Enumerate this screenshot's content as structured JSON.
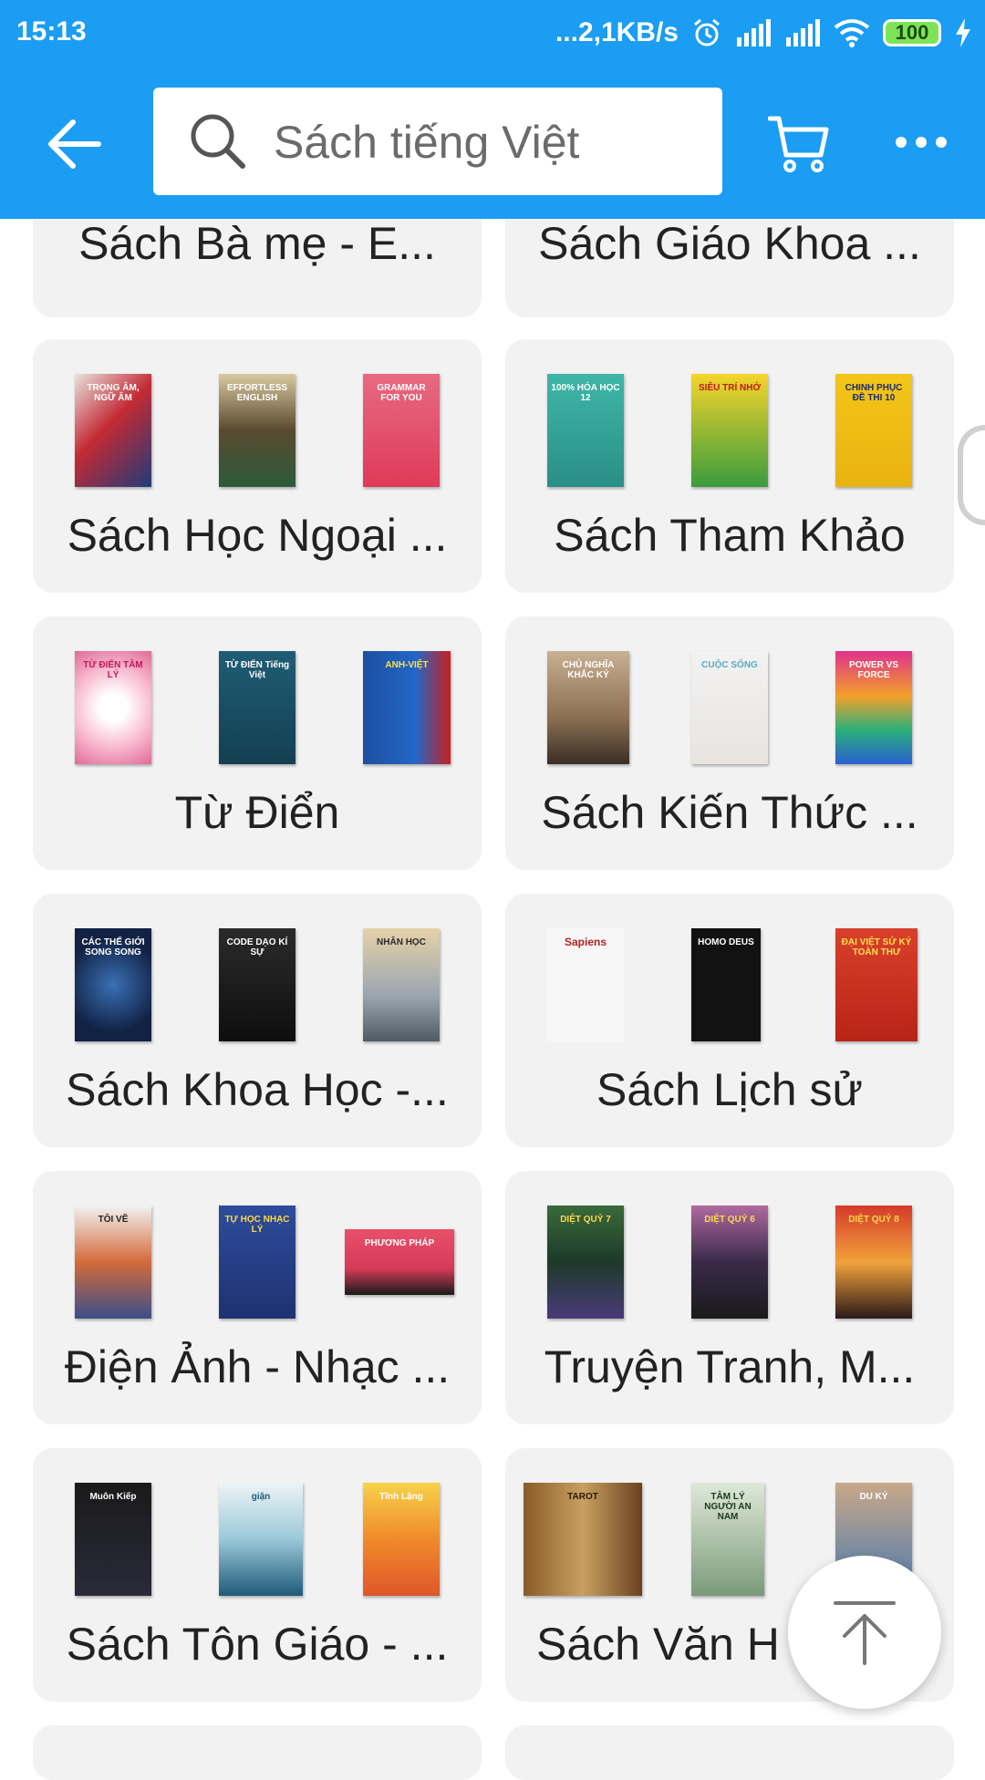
{
  "status_bar": {
    "time": "15:13",
    "network_speed": "...2,1KB/s",
    "battery": "100",
    "icons": [
      "alarm-icon",
      "signal-icon",
      "signal-icon",
      "wifi-icon",
      "battery-icon",
      "charging-icon"
    ]
  },
  "header": {
    "back_icon": "arrow-left-icon",
    "search_placeholder": "Sách tiếng Việt",
    "search_icon": "search-icon",
    "cart_icon": "cart-icon",
    "more_icon": "more-horizontal-icon",
    "background_color": "#1a9df2"
  },
  "categories": [
    {
      "label": "Sách Bà mẹ - E...",
      "books": []
    },
    {
      "label": "Sách Giáo Khoa ...",
      "books": []
    },
    {
      "label": "Sách Học Ngoại ...",
      "books": [
        "TRỌNG ÂM, NGỮ ÂM",
        "EFFORTLESS ENGLISH",
        "GRAMMAR FOR YOU"
      ]
    },
    {
      "label": "Sách Tham Khảo",
      "books": [
        "100% HÓA HỌC 12",
        "SIÊU TRÍ NHỚ",
        "CHINH PHỤC ĐỀ THI 10"
      ]
    },
    {
      "label": "Từ Điển",
      "books": [
        "TỪ ĐIỂN TÂM LÝ",
        "TỪ ĐIỂN Tiếng Việt",
        "ANH-VIỆT"
      ]
    },
    {
      "label": "Sách Kiến Thức ...",
      "books": [
        "CHỦ NGHĨA KHẮC KỶ",
        "CUỘC SỐNG",
        "POWER VS FORCE"
      ]
    },
    {
      "label": "Sách Khoa Học -...",
      "books": [
        "CÁC THẾ GIỚI SONG SONG",
        "CODE DẠO KÍ SỰ",
        "NHÂN HỌC"
      ]
    },
    {
      "label": "Sách Lịch sử",
      "books": [
        "Sapiens",
        "HOMO DEUS",
        "ĐẠI VIỆT SỬ KÝ TOÀN THƯ"
      ]
    },
    {
      "label": "Điện Ảnh - Nhạc ...",
      "books": [
        "TÔI VẼ",
        "TỰ HỌC NHẠC LÝ",
        "PHƯƠNG PHÁP"
      ]
    },
    {
      "label": "Truyện Tranh, M...",
      "books": [
        "DIỆT QUỶ 7",
        "DIỆT QUỶ 6",
        "DIỆT QUỶ 8"
      ]
    },
    {
      "label": "Sách Tôn Giáo - ...",
      "books": [
        "Muôn Kiếp",
        "giận",
        "Tĩnh Lặng"
      ]
    },
    {
      "label": "Sách Văn H",
      "books": [
        "TAROT",
        "TÂM LÝ NGƯỜI AN NAM",
        "DU KÝ"
      ]
    }
  ],
  "scroll_to_top_icon": "arrow-up-icon"
}
